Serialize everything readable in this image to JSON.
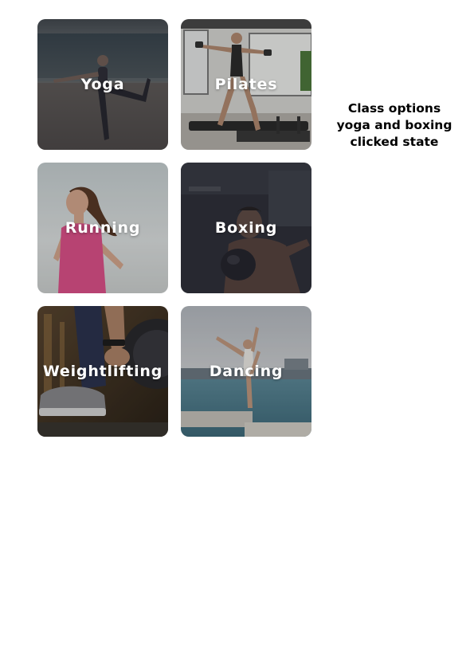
{
  "classes": [
    {
      "label": "Yoga",
      "selected": true
    },
    {
      "label": "Pilates",
      "selected": false
    },
    {
      "label": "Running",
      "selected": false
    },
    {
      "label": "Boxing",
      "selected": true
    },
    {
      "label": "Weightlifting",
      "selected": false
    },
    {
      "label": "Dancing",
      "selected": false
    }
  ],
  "annotation": {
    "line1": "Class options",
    "line2": "yoga and boxing",
    "line3": "clicked state"
  }
}
